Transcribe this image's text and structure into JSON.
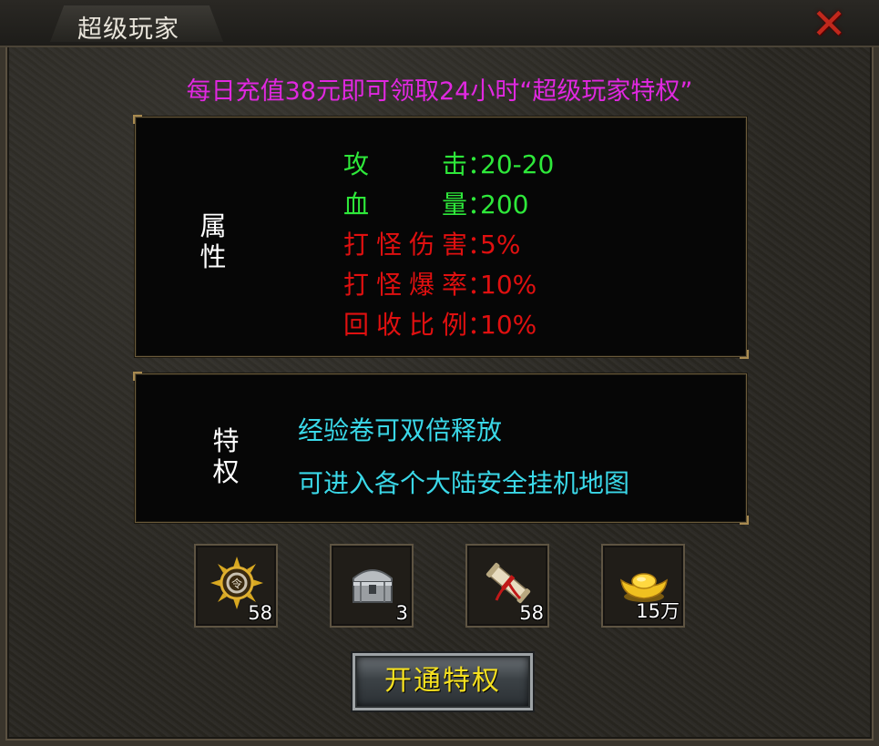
{
  "window": {
    "title": "超级玩家",
    "close_icon": "close-icon"
  },
  "headline": "每日充值38元即可领取24小时“超级玩家特权”",
  "attributes": {
    "label": "属性",
    "label_chars": [
      "属",
      "性"
    ],
    "rows": [
      {
        "key": "攻击",
        "colon": "：",
        "value": "20-20",
        "color": "#2ee83a"
      },
      {
        "key": "血量",
        "colon": "：",
        "value": "200",
        "color": "#2ee83a"
      },
      {
        "key": "打怪伤害",
        "colon": "：",
        "value": "5%",
        "color": "#e01010"
      },
      {
        "key": "打怪爆率",
        "colon": "：",
        "value": "10%",
        "color": "#e01010"
      },
      {
        "key": "回收比例",
        "colon": "：",
        "value": "10%",
        "color": "#e01010"
      }
    ]
  },
  "privileges": {
    "label": "特权",
    "label_chars": [
      "特",
      "权"
    ],
    "lines": [
      "经验卷可双倍释放",
      "可进入各个大陆安全挂机地图"
    ],
    "color": "#3ad8e8"
  },
  "rewards": [
    {
      "icon": "golden-sun-medal-icon",
      "count": "58"
    },
    {
      "icon": "silver-treasure-chest-icon",
      "count": "3"
    },
    {
      "icon": "scroll-icon",
      "count": "58"
    },
    {
      "icon": "gold-ingot-icon",
      "count": "15万"
    }
  ],
  "open_button": {
    "label": "开通特权"
  }
}
